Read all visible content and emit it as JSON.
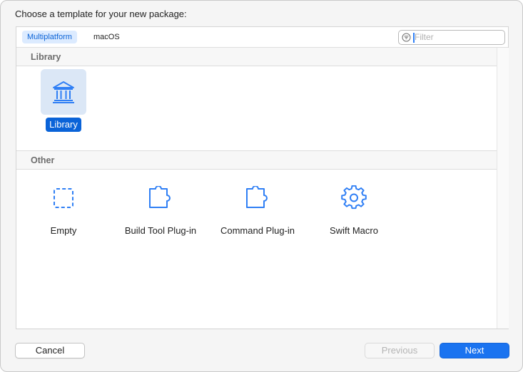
{
  "dialog": {
    "title": "Choose a template for your new package:"
  },
  "platform_tabs": [
    {
      "label": "Multiplatform",
      "selected": true
    },
    {
      "label": "macOS",
      "selected": false
    }
  ],
  "filter": {
    "placeholder": "Filter",
    "value": ""
  },
  "sections": [
    {
      "title": "Library",
      "templates": [
        {
          "label": "Library",
          "icon": "building-columns-icon",
          "selected": true
        }
      ]
    },
    {
      "title": "Other",
      "templates": [
        {
          "label": "Empty",
          "icon": "dashed-square-icon",
          "selected": false
        },
        {
          "label": "Build Tool Plug-in",
          "icon": "puzzle-piece-icon",
          "selected": false
        },
        {
          "label": "Command Plug-in",
          "icon": "puzzle-piece-icon",
          "selected": false
        },
        {
          "label": "Swift Macro",
          "icon": "gear-icon",
          "selected": false
        }
      ]
    }
  ],
  "buttons": {
    "cancel": "Cancel",
    "previous": "Previous",
    "next": "Next"
  },
  "colors": {
    "accent": "#1a73f0",
    "icon": "#2f7ff5",
    "selection_bg": "#dbe7f6"
  }
}
